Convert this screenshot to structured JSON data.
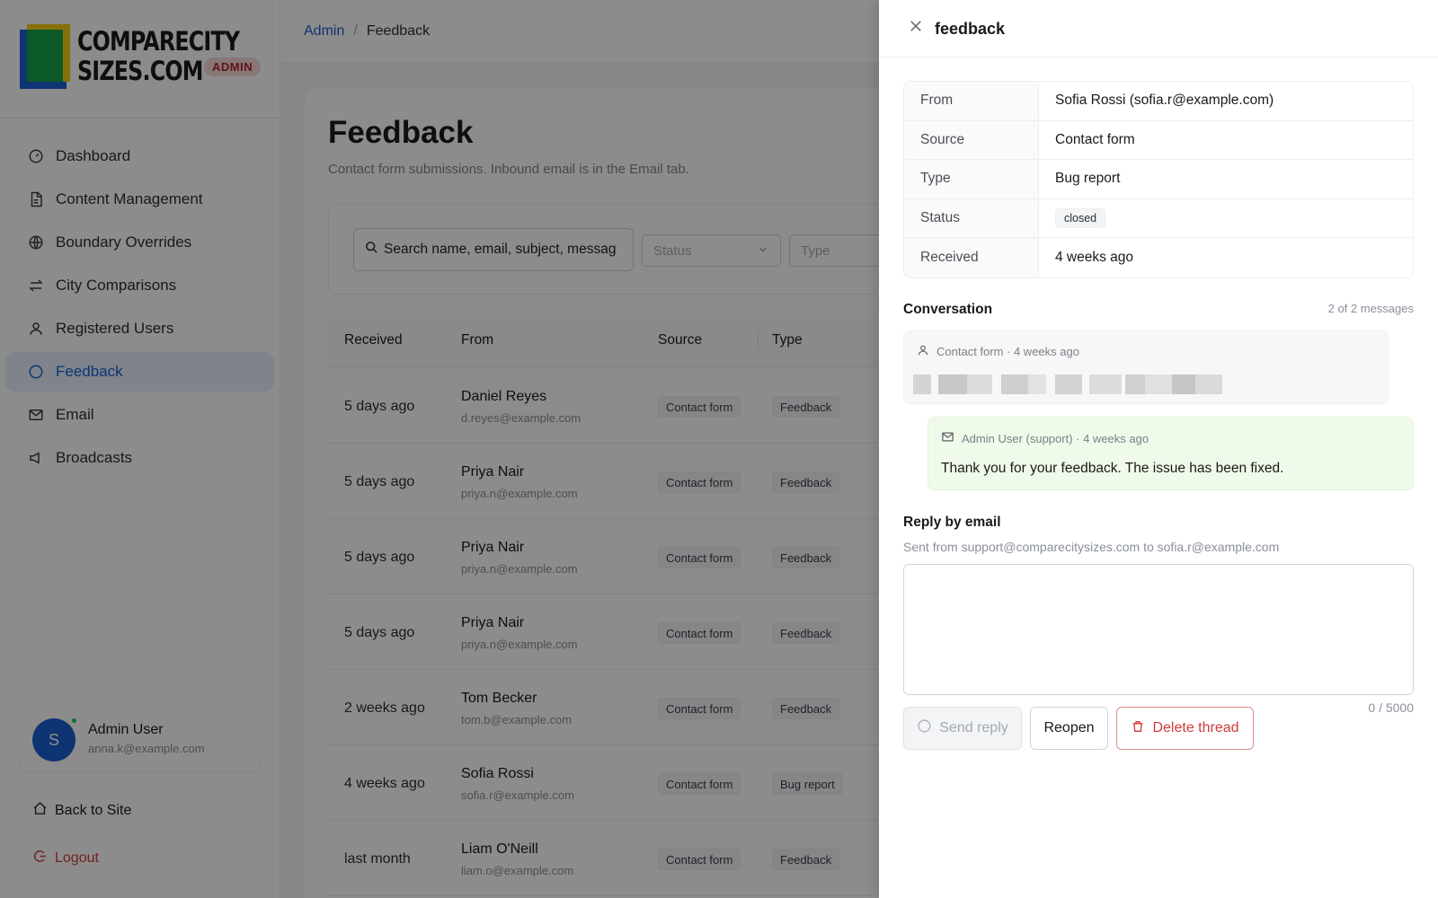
{
  "brand": {
    "logo_text_line1": "COMPARECITY",
    "logo_text_line2": "SIZES.COM",
    "badge": "ADMIN"
  },
  "sidebar": {
    "items": [
      {
        "label": "Dashboard",
        "icon": "dashboard-icon"
      },
      {
        "label": "Content Management",
        "icon": "document-icon"
      },
      {
        "label": "Boundary Overrides",
        "icon": "globe-icon"
      },
      {
        "label": "City Comparisons",
        "icon": "compare-arrows-icon"
      },
      {
        "label": "Registered Users",
        "icon": "user-icon"
      },
      {
        "label": "Feedback",
        "icon": "chat-bubble-icon",
        "active": true
      },
      {
        "label": "Email",
        "icon": "mail-icon"
      },
      {
        "label": "Broadcasts",
        "icon": "megaphone-icon"
      }
    ],
    "user": {
      "initial": "S",
      "name": "Admin User",
      "email": "anna.k@example.com"
    },
    "back_to_site": "Back to Site",
    "logout": "Logout"
  },
  "breadcrumb": {
    "root": "Admin",
    "separator": "/",
    "current": "Feedback"
  },
  "page": {
    "title": "Feedback",
    "subtitle": "Contact form submissions. Inbound email is in the Email tab."
  },
  "filters": {
    "search_value": "Search name, email, subject, messag",
    "status_placeholder": "Status",
    "type_placeholder": "Type"
  },
  "table": {
    "headers": {
      "received": "Received",
      "from": "From",
      "source": "Source",
      "type": "Type"
    },
    "rows": [
      {
        "received": "5 days ago",
        "name": "Daniel Reyes",
        "email": "d.reyes@example.com",
        "source": "Contact form",
        "type": "Feedback"
      },
      {
        "received": "5 days ago",
        "name": "Priya Nair",
        "email": "priya.n@example.com",
        "source": "Contact form",
        "type": "Feedback"
      },
      {
        "received": "5 days ago",
        "name": "Priya Nair",
        "email": "priya.n@example.com",
        "source": "Contact form",
        "type": "Feedback"
      },
      {
        "received": "5 days ago",
        "name": "Priya Nair",
        "email": "priya.n@example.com",
        "source": "Contact form",
        "type": "Feedback"
      },
      {
        "received": "2 weeks ago",
        "name": "Tom Becker",
        "email": "tom.b@example.com",
        "source": "Contact form",
        "type": "Feedback"
      },
      {
        "received": "4 weeks ago",
        "name": "Sofia Rossi",
        "email": "sofia.r@example.com",
        "source": "Contact form",
        "type": "Bug report"
      },
      {
        "received": "last month",
        "name": "Liam O'Neill",
        "email": "liam.o@example.com",
        "source": "Contact form",
        "type": "Feedback"
      }
    ]
  },
  "drawer": {
    "title": "feedback",
    "details": {
      "from_label": "From",
      "from_value": "Sofia Rossi (sofia.r@example.com)",
      "source_label": "Source",
      "source_value": "Contact form",
      "type_label": "Type",
      "type_value": "Bug report",
      "status_label": "Status",
      "status_value": "closed",
      "received_label": "Received",
      "received_value": "4 weeks ago"
    },
    "conversation": {
      "title": "Conversation",
      "count": "2 of 2 messages",
      "messages": [
        {
          "meta": "Contact form · 4 weeks ago",
          "icon": "user-icon"
        },
        {
          "meta": "Admin User (support) · 4 weeks ago",
          "icon": "mail-icon",
          "text": "Thank you for your feedback. The issue has been fixed."
        }
      ]
    },
    "reply": {
      "title": "Reply by email",
      "subtitle": "Sent from support@comparecitysizes.com to sofia.r@example.com",
      "value": "",
      "char_count": "0 / 5000",
      "send_label": "Send reply",
      "reopen_label": "Reopen",
      "delete_label": "Delete thread"
    }
  },
  "colors": {
    "accent": "#1d5fd0",
    "danger": "#d03a3a",
    "admin_reply_bg": "#f0faea"
  }
}
